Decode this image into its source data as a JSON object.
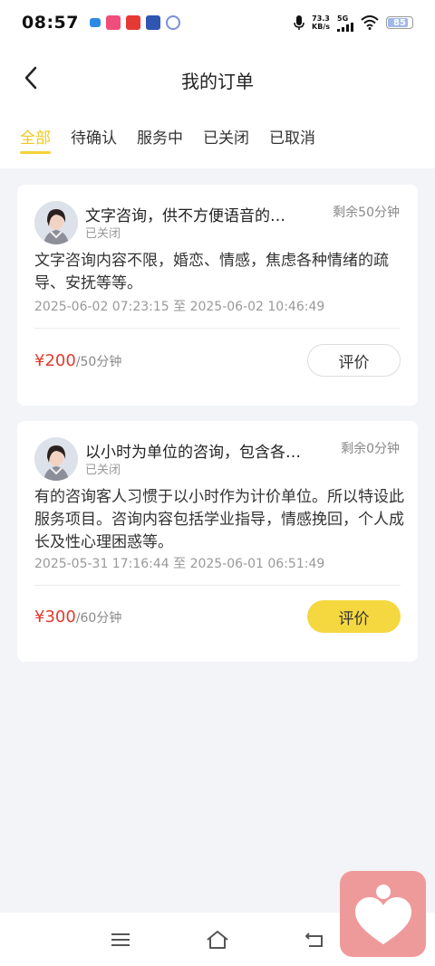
{
  "status_bar": {
    "time": "08:57",
    "net_speed_value": "73.3",
    "net_speed_unit": "KB/s",
    "signal_label": "5G",
    "battery": "85",
    "battery_level": 0.85,
    "apps": [
      "app-icon-blue",
      "app-icon-pink",
      "app-icon-red",
      "app-icon-navy",
      "app-icon-circle"
    ]
  },
  "header": {
    "title": "我的订单"
  },
  "tabs": [
    {
      "label": "全部",
      "active": true
    },
    {
      "label": "待确认",
      "active": false
    },
    {
      "label": "服务中",
      "active": false
    },
    {
      "label": "已关闭",
      "active": false
    },
    {
      "label": "已取消",
      "active": false
    }
  ],
  "orders": [
    {
      "title": "文字咨询，供不方便语音的…",
      "status": "已关闭",
      "remaining": "剩余50分钟",
      "description": "文字咨询内容不限，婚恋、情感，焦虑各种情绪的疏导、安抚等等。",
      "time_range": "2025-06-02 07:23:15 至 2025-06-02 10:46:49",
      "price": "¥200",
      "unit": "/50分钟",
      "action": "评价",
      "action_style": "outline"
    },
    {
      "title": "以小时为单位的咨询，包含各…",
      "status": "已关闭",
      "remaining": "剩余0分钟",
      "description": "有的咨询客人习惯于以小时作为计价单位。所以特设此服务项目。咨询内容包括学业指导，情感挽回，个人成长及性心理困惑等。",
      "time_range": "2025-05-31 17:16:44 至 2025-06-01 06:51:49",
      "price": "¥300",
      "unit": "/60分钟",
      "action": "评价",
      "action_style": "filled"
    }
  ],
  "colors": {
    "accent": "#f5d23a",
    "price": "#e23b2e",
    "background": "#f3f4f8",
    "fab": "#ef9a9a"
  },
  "navbar": {
    "icons": [
      "menu-icon",
      "home-icon",
      "back-nav-icon"
    ]
  },
  "fab": {
    "icon": "heart-person-icon"
  }
}
